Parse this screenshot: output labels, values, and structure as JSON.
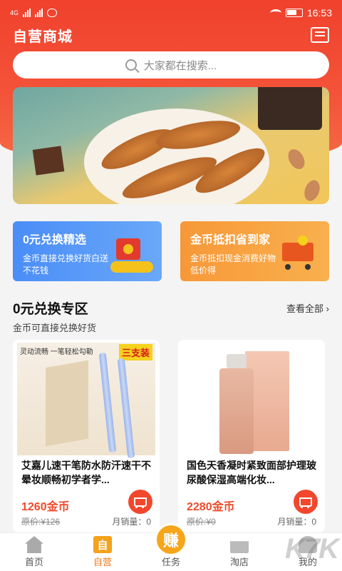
{
  "status": {
    "network": "4G",
    "time": "16:53"
  },
  "header": {
    "title": "自营商城"
  },
  "search": {
    "placeholder": "大家都在搜索..."
  },
  "promos": [
    {
      "title": "0元兑换精选",
      "desc": "金币直接兑换好货白送不花钱"
    },
    {
      "title": "金币抵扣省到家",
      "desc": "金币抵扣现金消费好物低价得"
    }
  ],
  "section": {
    "title": "0元兑换专区",
    "subtitle": "金币可直接兑换好货",
    "more": "查看全部 ›"
  },
  "products": [
    {
      "name": "艾嘉儿速干笔防水防汗速干不晕妆顺畅初学者学...",
      "price": "1260金币",
      "orig": "原价:¥126",
      "sales": "月销量：0",
      "tag": "三支装",
      "img_caption": "灵动流畅 一笔轻松勾勒"
    },
    {
      "name": "国色天香凝时紧致面部护理玻尿酸保湿高端化妆...",
      "price": "2280金币",
      "orig": "原价:¥0",
      "sales": "月销量：0"
    }
  ],
  "tabs": [
    {
      "label": "首页"
    },
    {
      "label": "自营",
      "icon_text": "自"
    },
    {
      "label": "任务",
      "icon_text": "赚"
    },
    {
      "label": "淘店"
    },
    {
      "label": "我的"
    }
  ],
  "watermark": "K7K"
}
